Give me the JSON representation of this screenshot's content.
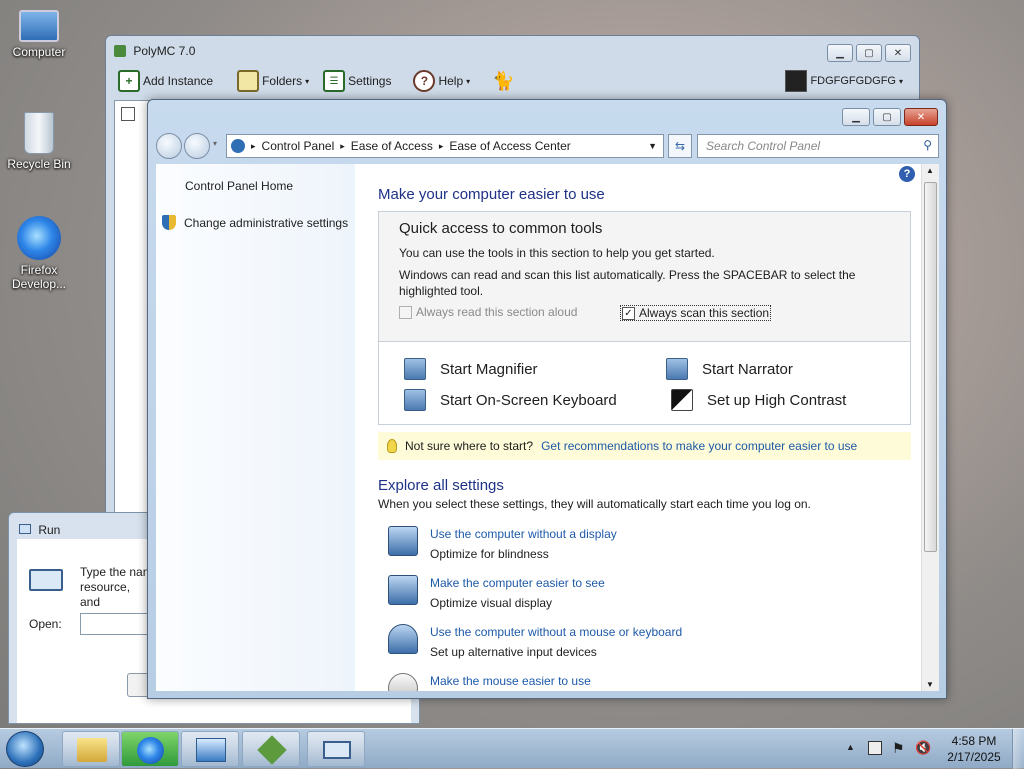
{
  "desktop": {
    "icons": [
      {
        "label": "Computer"
      },
      {
        "label": "Recycle Bin"
      },
      {
        "label": "Firefox Develop..."
      }
    ]
  },
  "polymc": {
    "title": "PolyMC 7.0",
    "toolbar": {
      "add_instance": "Add Instance",
      "folders": "Folders",
      "settings": "Settings",
      "help": "Help",
      "account": "FDGFGFGDGFG"
    }
  },
  "run": {
    "title": "Run",
    "description": "Type the nan resource, and",
    "open_label": "Open:"
  },
  "eoa": {
    "breadcrumb": [
      "Control Panel",
      "Ease of Access",
      "Ease of Access Center"
    ],
    "search_placeholder": "Search Control Panel",
    "left": {
      "home": "Control Panel Home",
      "admin": "Change administrative settings"
    },
    "main": {
      "heading": "Make your computer easier to use",
      "quick": {
        "title": "Quick access to common tools",
        "line1": "You can use the tools in this section to help you get started.",
        "line2": "Windows can read and scan this list automatically.  Press the SPACEBAR to select the highlighted tool.",
        "read_aloud": "Always read this section aloud",
        "scan": "Always scan this section",
        "read_aloud_checked": false,
        "scan_checked": true
      },
      "tools": [
        {
          "label": "Start Magnifier"
        },
        {
          "label": "Start Narrator"
        },
        {
          "label": "Start On-Screen Keyboard"
        },
        {
          "label": "Set up High Contrast"
        }
      ],
      "tip": {
        "text": "Not sure where to start?",
        "link": "Get recommendations to make your computer easier to use"
      },
      "explore": {
        "title": "Explore all settings",
        "subtitle": "When you select these settings, they will automatically start each time you log on.",
        "items": [
          {
            "link": "Use the computer without a display",
            "desc": "Optimize for blindness"
          },
          {
            "link": "Make the computer easier to see",
            "desc": "Optimize visual display"
          },
          {
            "link": "Use the computer without a mouse or keyboard",
            "desc": "Set up alternative input devices"
          },
          {
            "link": "Make the mouse easier to use",
            "desc": ""
          }
        ]
      }
    }
  },
  "taskbar": {
    "time": "4:58 PM",
    "date": "2/17/2025"
  }
}
